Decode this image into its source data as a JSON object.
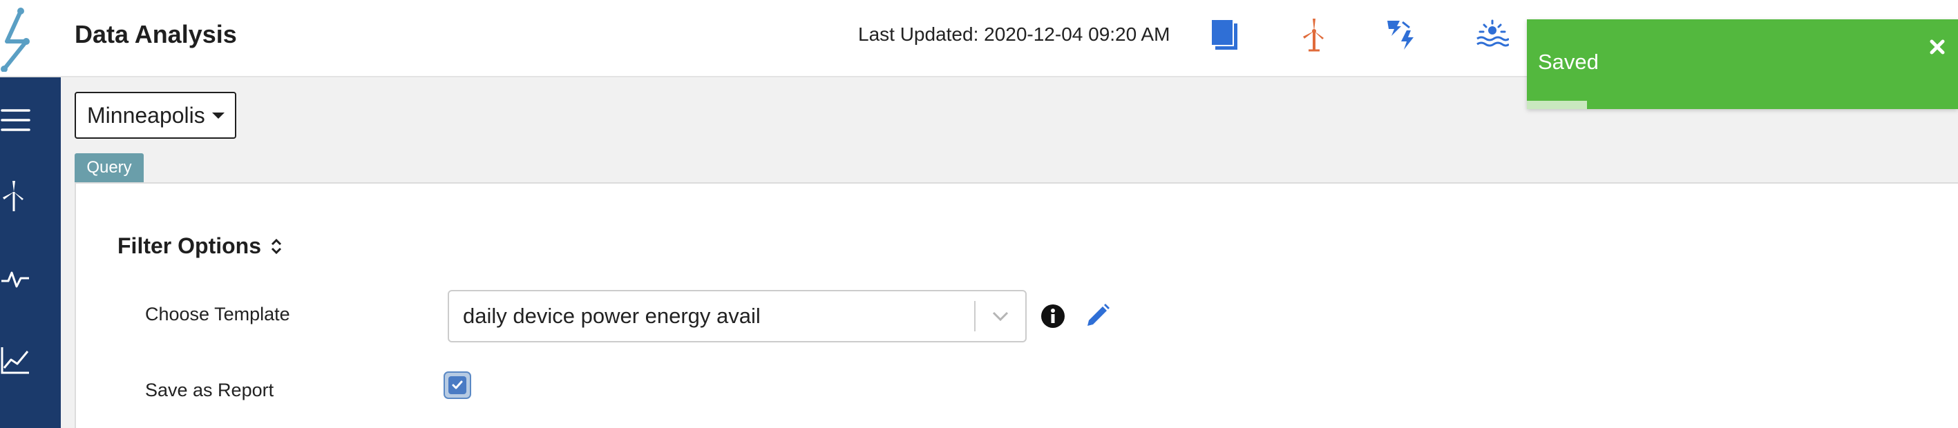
{
  "header": {
    "title": "Data Analysis",
    "last_updated": "Last Updated: 2020-12-04 09:20 AM",
    "icons": [
      "documents-icon",
      "wind-turbine-icon",
      "storm-power-icon",
      "solar-water-icon"
    ]
  },
  "sidebar": {
    "items": [
      {
        "icon": "menu-icon"
      },
      {
        "icon": "wind-turbine-icon"
      },
      {
        "icon": "pulse-icon"
      },
      {
        "icon": "line-chart-icon"
      }
    ]
  },
  "location": {
    "selected": "Minneapolis"
  },
  "tabs": [
    {
      "label": "Query",
      "active": true
    }
  ],
  "filter": {
    "title": "Filter Options",
    "template_label": "Choose Template",
    "template_value": "daily device power energy avail",
    "save_label": "Save as Report",
    "save_checked": true
  },
  "toast": {
    "message": "Saved",
    "progress": 0.14
  },
  "colors": {
    "sidebar": "#1b3a6b",
    "tab": "#6a9eaa",
    "toast": "#53b83e",
    "icon_blue": "#2f6fd6",
    "icon_orange": "#e06b3a"
  }
}
